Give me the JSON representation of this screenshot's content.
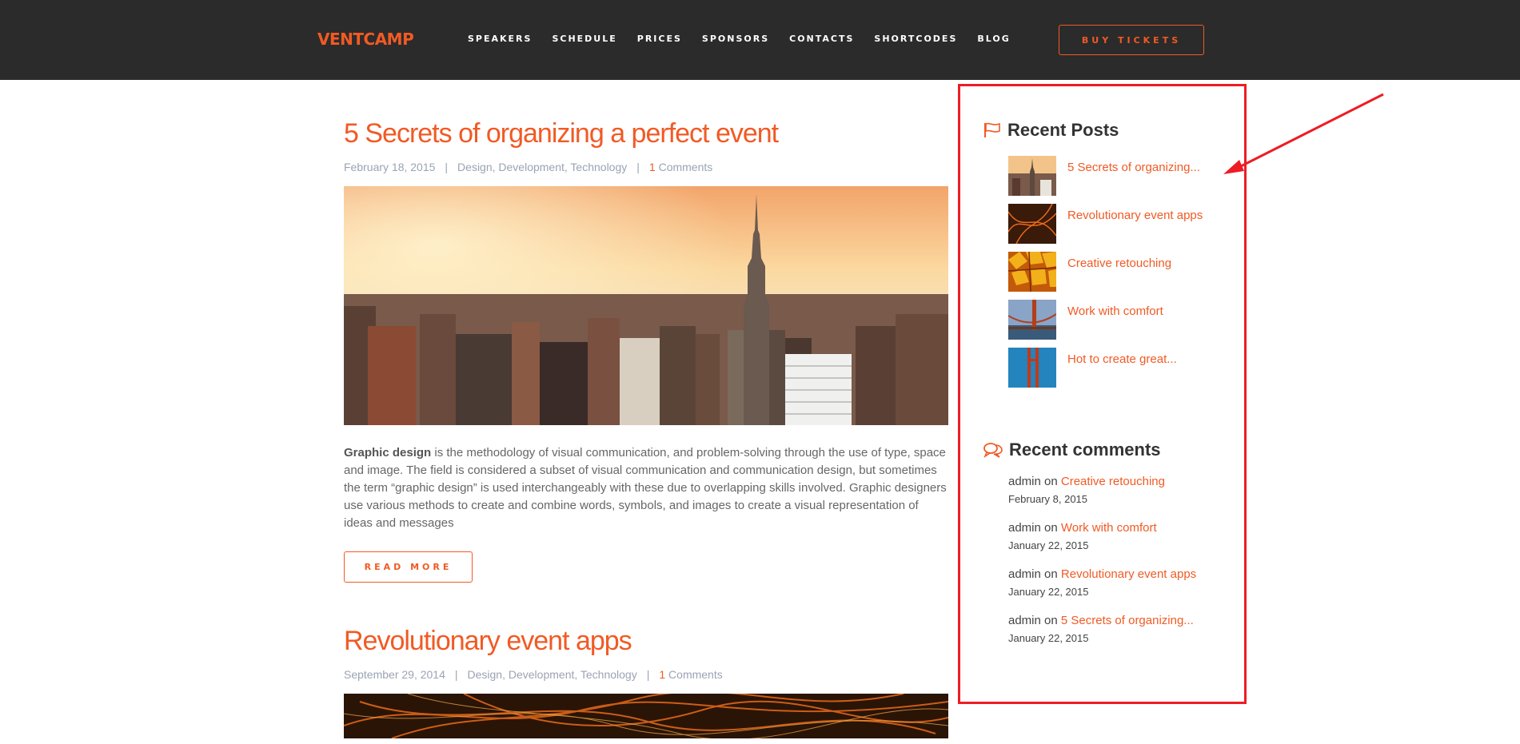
{
  "header": {
    "logo": "VENTCAMP",
    "nav": [
      "SPEAKERS",
      "SCHEDULE",
      "PRICES",
      "SPONSORS",
      "CONTACTS",
      "SHORTCODES",
      "BLOG"
    ],
    "buy_label": "BUY TICKETS"
  },
  "posts": [
    {
      "title": "5 Secrets of organizing a perfect event",
      "date": "February 18, 2015",
      "categories": "Design, Development, Technology",
      "comments_count": "1",
      "comments_label": "Comments",
      "excerpt_bold": "Graphic design",
      "excerpt": " is the methodology of visual communication, and problem-solving through the use of type, space and image. The field is considered a subset of visual communication and communication design, but sometimes the term “graphic design” is used interchangeably with these due to overlapping skills involved. Graphic designers use various methods to create and combine words, symbols, and images to create a visual representation of ideas and messages",
      "read_more": "READ MORE"
    },
    {
      "title": "Revolutionary event apps",
      "date": "September 29, 2014",
      "categories": "Design, Development, Technology",
      "comments_count": "1",
      "comments_label": "Comments"
    }
  ],
  "sidebar": {
    "recent_posts_title": "Recent Posts",
    "recent_posts": [
      "5 Secrets of organizing...",
      "Revolutionary event apps",
      "Creative retouching",
      "Work with comfort",
      "Hot to create great..."
    ],
    "recent_comments_title": "Recent comments",
    "recent_comments": [
      {
        "author": "admin",
        "on": "on",
        "post": "Creative retouching",
        "date": "February 8, 2015"
      },
      {
        "author": "admin",
        "on": "on",
        "post": "Work with comfort",
        "date": "January 22, 2015"
      },
      {
        "author": "admin",
        "on": "on",
        "post": "Revolutionary event apps",
        "date": "January 22, 2015"
      },
      {
        "author": "admin",
        "on": "on",
        "post": "5 Secrets of organizing...",
        "date": "January 22, 2015"
      }
    ]
  },
  "colors": {
    "accent": "#f15a24",
    "header_bg": "#2b2b2b",
    "highlight_box": "#ee1c25"
  },
  "icons": {
    "recent_posts": "flag-icon",
    "recent_comments": "comments-icon"
  }
}
